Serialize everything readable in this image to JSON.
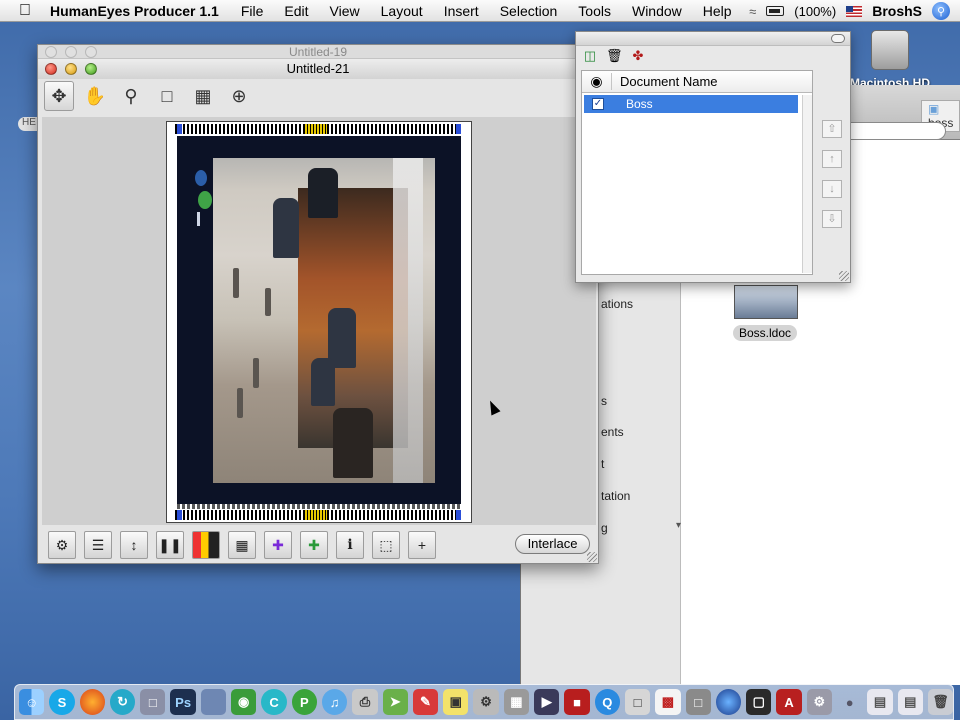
{
  "menubar": {
    "app_name": "HumanEyes Producer 1.1",
    "items": [
      "File",
      "Edit",
      "View",
      "Layout",
      "Insert",
      "Selection",
      "Tools",
      "Window",
      "Help"
    ],
    "battery": "(100%)",
    "user": "BroshS"
  },
  "desktop": {
    "hd_label": "Macintosh HD"
  },
  "finder": {
    "path_label": "boss",
    "sidebar_fragments": [
      "ations",
      "s",
      "ents",
      "t",
      "tation",
      "g"
    ],
    "file_label": "Boss.ldoc",
    "left_edge_label": "HE"
  },
  "main_window": {
    "back_title": "Untitled-19",
    "title": "Untitled-21",
    "interlace_label": "Interlace"
  },
  "layers_panel": {
    "column_header": "Document Name",
    "rows": [
      {
        "name": "Boss",
        "checked": true
      }
    ]
  },
  "colors": {
    "selection_blue": "#3b7ee0",
    "desktop_blue": "#4d79b8"
  }
}
